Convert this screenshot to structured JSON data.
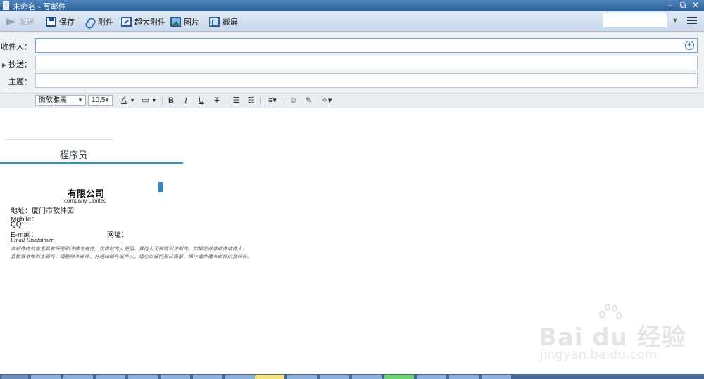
{
  "window": {
    "title": "未命名 - 写邮件"
  },
  "toolbar": {
    "send": "发送",
    "save": "保存",
    "attach": "附件",
    "big_attach": "超大附件",
    "image": "图片",
    "screenshot": "截屏"
  },
  "fields": {
    "to_label": "收件人：",
    "cc_label": "抄送：",
    "subject_label": "主题：",
    "to_value": "",
    "cc_value": "",
    "subject_value": ""
  },
  "format": {
    "font": "微软雅黑",
    "size": "10.5",
    "font_color": "A",
    "bold": "B",
    "italic": "I",
    "underline": "U",
    "strike": "T"
  },
  "signature": {
    "title": "程序员",
    "company": "有限公司",
    "company_en": "company Limited",
    "address": "地址：厦门市软件园",
    "mobile": "Mobile：",
    "qq": "QQ:",
    "email": "E-mail：",
    "website": "网址：",
    "disclaimer_title": "Email Disclaimer",
    "disclaimer_1": "本邮件内的信息具有保密和法律专有性，仅供收件人使用。其他人无权收到该邮件。如果您并非邮件收件人，",
    "disclaimer_2": "且错误地收到本邮件，请删除本邮件，并通知邮件发件人，请勿以任何形式保留、保存或传播本邮件的复印件。"
  },
  "watermark": {
    "brand": "Bai du 经验",
    "url": "jingyan.baidu.com"
  },
  "colors": {
    "titlebar": "#3a6ea5",
    "accent": "#2e8fd1",
    "toolbar": "#c8d9ec"
  }
}
